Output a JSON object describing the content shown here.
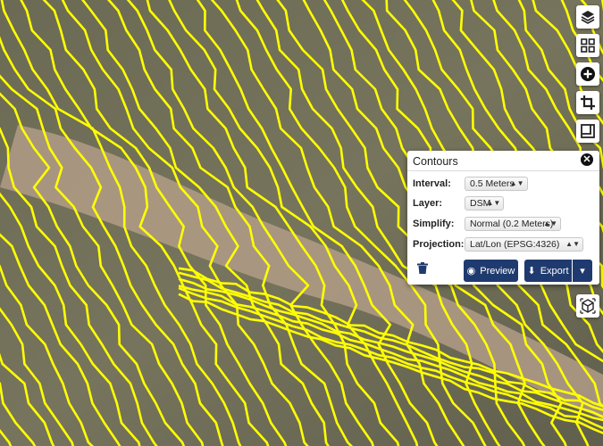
{
  "colors": {
    "contour": "#ffff00",
    "primary_button": "#1f3a6e",
    "panel_bg": "#ffffff"
  },
  "toolbar": {
    "buttons": [
      {
        "icon": "layers-icon"
      },
      {
        "icon": "grid-icon"
      },
      {
        "icon": "zoom-in-icon"
      },
      {
        "icon": "crop-icon"
      },
      {
        "icon": "measure-icon"
      },
      {
        "icon": "cube-icon"
      }
    ]
  },
  "contours_panel": {
    "title": "Contours",
    "close_icon": "close-icon",
    "fields": {
      "interval": {
        "label": "Interval:",
        "value": "0.5 Meters"
      },
      "layer": {
        "label": "Layer:",
        "value": "DSM"
      },
      "simplify": {
        "label": "Simplify:",
        "value": "Normal (0.2 Meters)"
      },
      "projection": {
        "label": "Projection:",
        "value": "Lat/Lon (EPSG:4326)"
      }
    },
    "delete_icon": "trash-icon",
    "preview_label": "Preview",
    "preview_icon": "eye-icon",
    "export_label": "Export",
    "export_icon": "download-icon",
    "export_menu_icon": "caret-down-icon"
  }
}
